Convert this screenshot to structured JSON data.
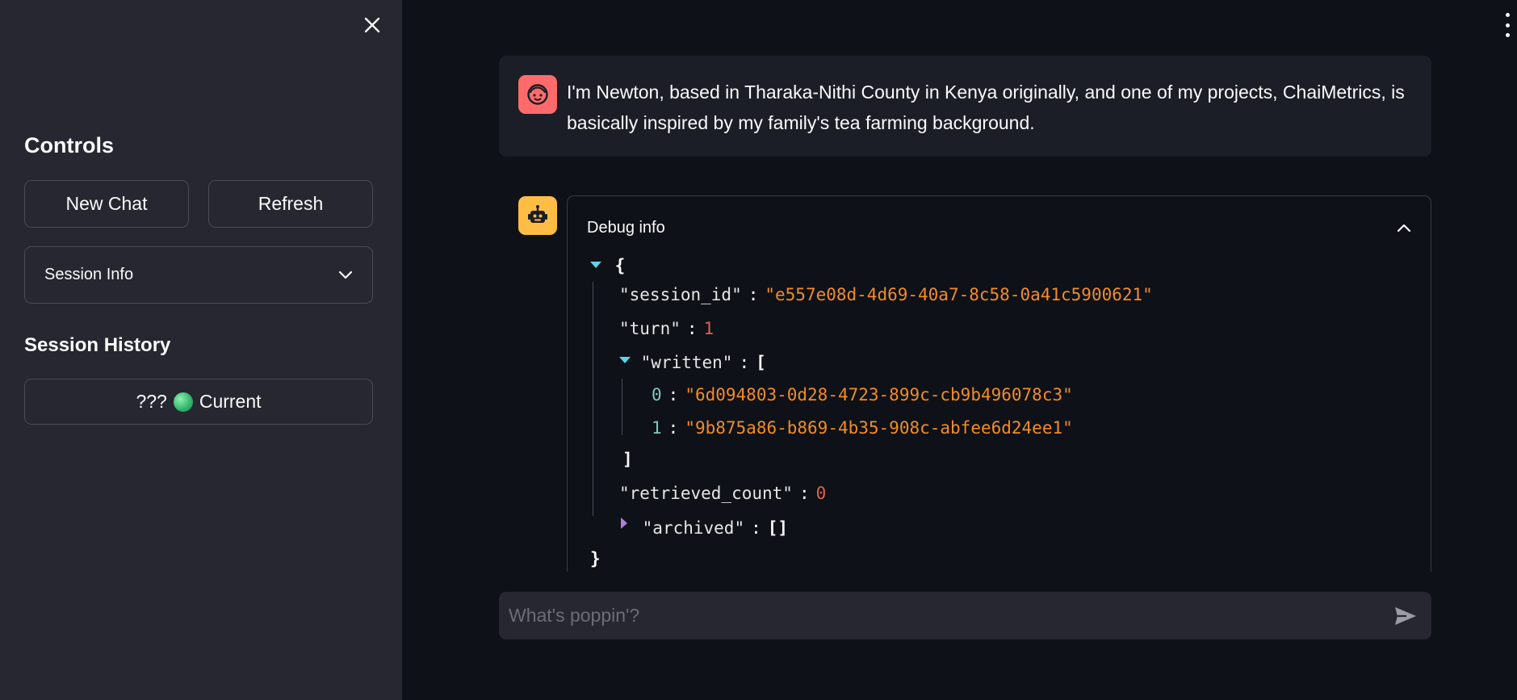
{
  "sidebar": {
    "controls_heading": "Controls",
    "new_chat_label": "New Chat",
    "refresh_label": "Refresh",
    "session_info_label": "Session Info",
    "history_heading": "Session History",
    "current_session": {
      "prefix": "???",
      "status_icon": "green-circle",
      "label": "Current"
    },
    "close_icon": "close-icon"
  },
  "chat": {
    "user_message": "I'm Newton, based in Tharaka-Nithi County in Kenya originally, and one of my projects, ChaiMetrics, is basically inspired by my family's tea farming background.",
    "user_avatar_icon": "face-icon",
    "bot_avatar_icon": "robot-icon",
    "debug": {
      "label": "Debug info",
      "open_brace": "{",
      "close_brace": "}",
      "session_id_key": "\"session_id\"",
      "session_id_value": "\"e557e08d-4d69-40a7-8c58-0a41c5900621\"",
      "turn_key": "\"turn\"",
      "turn_value": "1",
      "written_key": "\"written\"",
      "written_open": "[",
      "written_close": "]",
      "written_items": [
        {
          "index": "0",
          "value": "\"6d094803-0d28-4723-899c-cb9b496078c3\""
        },
        {
          "index": "1",
          "value": "\"9b875a86-b869-4b35-908c-abfee6d24ee1\""
        }
      ],
      "retrieved_count_key": "\"retrieved_count\"",
      "retrieved_count_value": "0",
      "archived_key": "\"archived\"",
      "archived_value": "[]"
    }
  },
  "input": {
    "placeholder": "What's poppin'?"
  },
  "colors": {
    "background": "#0e1117",
    "sidebar": "#262730",
    "user_avatar": "#ff6b6b",
    "bot_avatar": "#ffbd45",
    "json_string": "#f28c28"
  }
}
